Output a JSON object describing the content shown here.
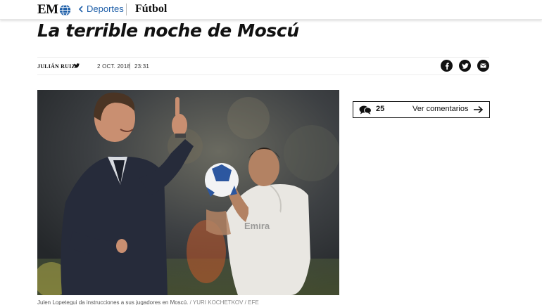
{
  "header": {
    "logo_text": "EM",
    "logo_icon": "globe-icon",
    "breadcrumb_section": "Deportes",
    "breadcrumb_subsection": "Fútbol"
  },
  "article": {
    "title": "La terrible noche de Moscú",
    "author": "JULIÁN RUIZ",
    "date": "2 OCT. 2018",
    "time": "23:31",
    "share_icons": [
      "facebook-icon",
      "twitter-icon",
      "email-icon"
    ],
    "photo_caption": "Julen Lopetegui da instrucciones a sus jugadores en Moscú.",
    "photo_credit": "/ YURI KOCHETKOV / EFE"
  },
  "comments": {
    "count": "25",
    "link_label": "Ver comentarios"
  },
  "colors": {
    "link_blue": "#1d5ea8",
    "text_dark": "#111111"
  }
}
